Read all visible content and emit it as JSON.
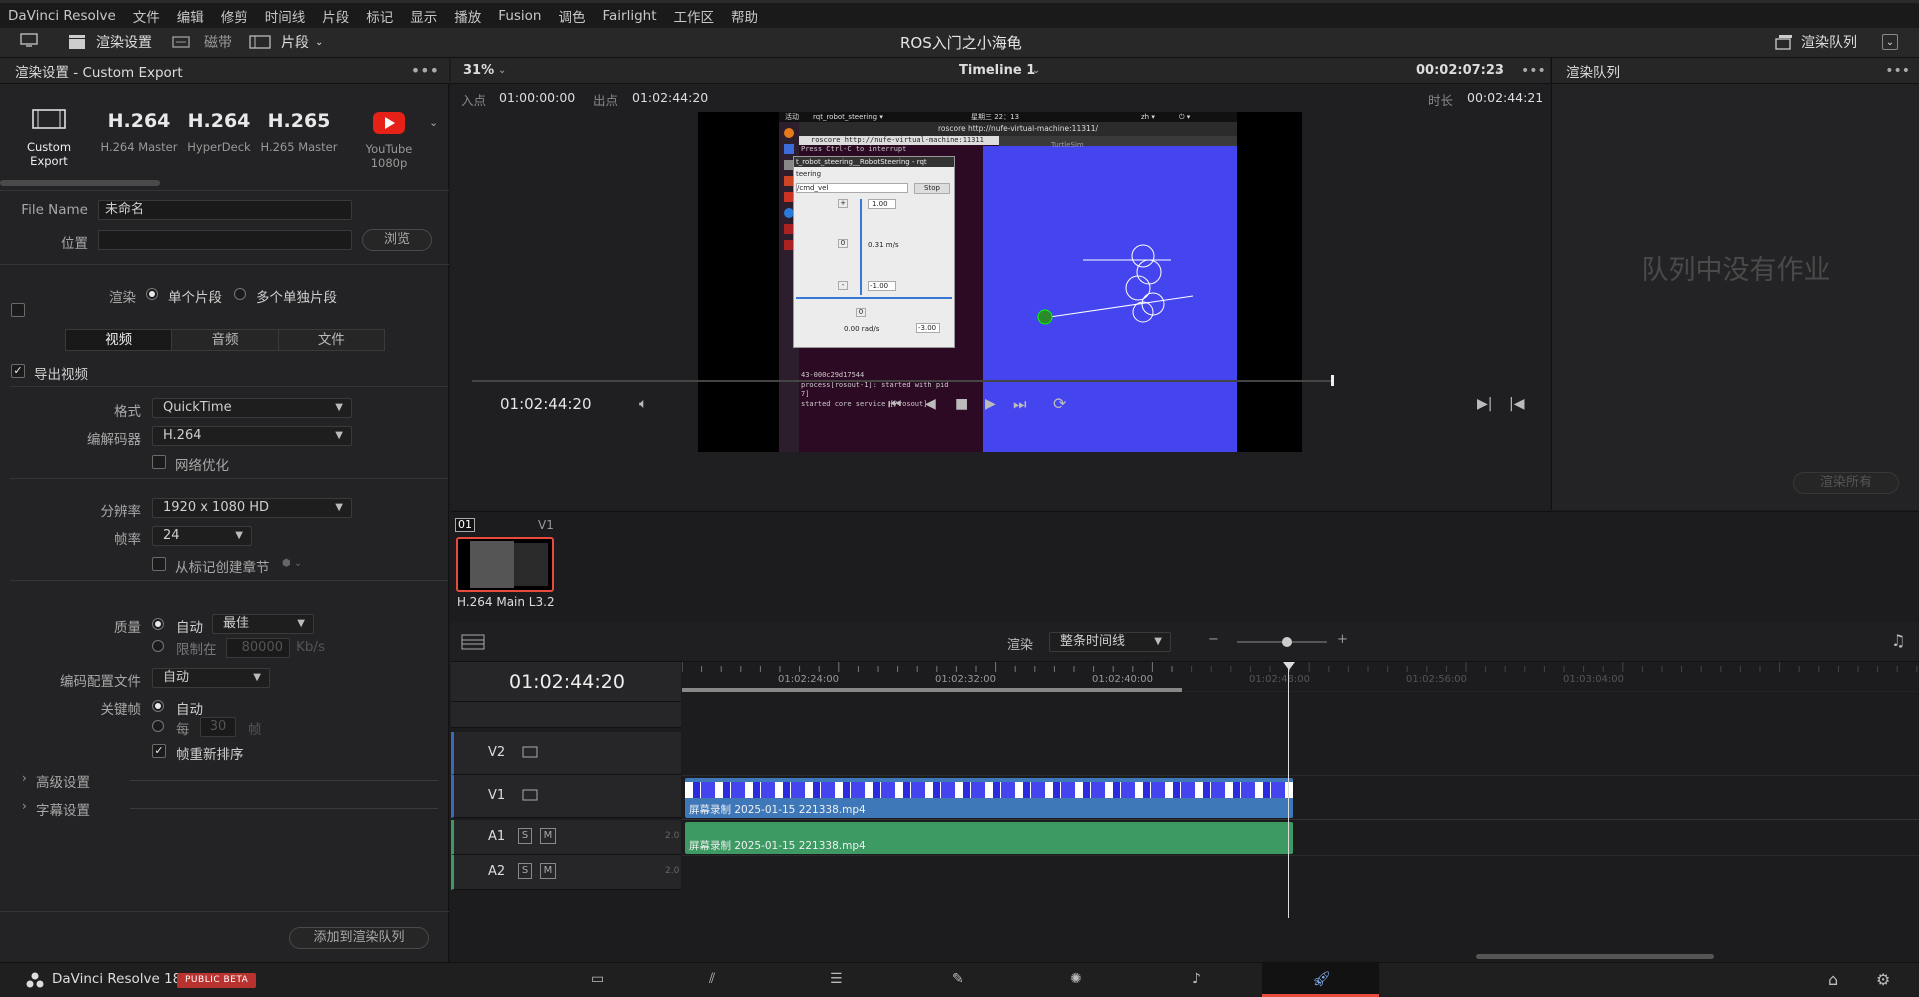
{
  "menubar": {
    "items": [
      "DaVinci Resolve",
      "文件",
      "编辑",
      "修剪",
      "时间线",
      "片段",
      "标记",
      "显示",
      "播放",
      "Fusion",
      "调色",
      "Fairlight",
      "工作区",
      "帮助"
    ]
  },
  "toolbar": {
    "render_settings": "渲染设置",
    "tape": "磁带",
    "clips": "片段",
    "project_title": "ROS入门之小海龟",
    "render_queue": "渲染队列"
  },
  "render_settings": {
    "title": "渲染设置 - Custom Export",
    "presets": [
      {
        "name": "Custom Export",
        "label": ""
      },
      {
        "name": "H.264 Master",
        "label": "H.264"
      },
      {
        "name": "HyperDeck",
        "label": "H.264"
      },
      {
        "name": "H.265 Master",
        "label": "H.265"
      },
      {
        "name": "YouTube 1080p",
        "label": ""
      }
    ],
    "file_name_label": "File Name",
    "file_name": "未命名",
    "location_label": "位置",
    "location": "",
    "browse": "浏览",
    "render_label": "渲染",
    "single_clip": "单个片段",
    "multiple_clips": "多个单独片段",
    "tabs": [
      "视频",
      "音频",
      "文件"
    ],
    "export_video": "导出视频",
    "format_label": "格式",
    "format": "QuickTime",
    "codec_label": "编解码器",
    "codec": "H.264",
    "network_opt": "网络优化",
    "resolution_label": "分辨率",
    "resolution": "1920 x 1080 HD",
    "fps_label": "帧率",
    "fps": "24",
    "chapters": "从标记创建章节",
    "quality_label": "质量",
    "quality_auto": "自动",
    "quality": "最佳",
    "limit_label": "限制在",
    "limit_value": "80000",
    "limit_unit": "Kb/s",
    "profile_label": "编码配置文件",
    "profile": "自动",
    "keyframe_label": "关键帧",
    "keyframe_auto": "自动",
    "keyframe_every": "每",
    "keyframe_value": "30",
    "keyframe_unit": "帧",
    "reorder": "帧重新排序",
    "advanced": "高级设置",
    "subtitle": "字幕设置",
    "add_queue": "添加到渲染队列"
  },
  "viewer": {
    "zoom": "31%",
    "timeline": "Timeline 1",
    "tc_top": "00:02:07:23",
    "in_label": "入点",
    "in_tc": "01:00:00:00",
    "out_label": "出点",
    "out_tc": "01:02:44:20",
    "dur_label": "时长",
    "dur_tc": "00:02:44:21",
    "current_tc": "01:02:44:20",
    "screen": {
      "top_bar_left": "活动",
      "app": "rqt_robot_steering ▾",
      "clock": "星期三 22：13",
      "lang": "zh ▾",
      "terminal_title": "roscore http://nufe-virtual-machine:11311/",
      "term_tab": "roscore http://nufe-virtual-machine:11311",
      "term_line1": "Press Ctrl-C to interrupt",
      "steer_title": "t_robot_steering__RobotSteering - rqt",
      "steer_sub": "teering",
      "topic": "/cmd_vel",
      "stop": "Stop",
      "max_lin": "1.00",
      "lin_val": "0.31 m/s",
      "min_lin": "-1.00",
      "zero1": "0",
      "zero2": "0",
      "ang_val": "0.00 rad/s",
      "ang_min": "-3.00",
      "plus": "+",
      "minus": "-",
      "term_line2": "43-000c29d17544",
      "term_line3": "process[rosout-1]: started with pid",
      "term_line4": "7]",
      "term_line5": "started core service [/rosout]",
      "turtlesim": "TurtleSim"
    }
  },
  "clip": {
    "index": "01",
    "track": "V1",
    "codec": "H.264 Main L3.2"
  },
  "render_queue": {
    "title": "渲染队列",
    "empty": "队列中没有作业",
    "render_all": "渲染所有"
  },
  "timeline": {
    "render_label": "渲染",
    "render_mode": "整条时间线",
    "timecode": "01:02:44:20",
    "ruler": [
      "01:02:24:00",
      "01:02:32:00",
      "01:02:40:00",
      "01:02:48:00",
      "01:02:56:00",
      "01:03:04:00"
    ],
    "tracks": [
      {
        "name": "V2"
      },
      {
        "name": "V1"
      },
      {
        "name": "A1",
        "s": "S",
        "m": "M",
        "ch": "2.0"
      },
      {
        "name": "A2",
        "s": "S",
        "m": "M",
        "ch": "2.0"
      }
    ],
    "clip_name": "屏幕录制 2025-01-15 221338.mp4"
  },
  "footer": {
    "app": "DaVinci Resolve 18",
    "badge": "PUBLIC BETA"
  },
  "colors": {
    "accent": "#e64b3c",
    "video_clip": "#3f78b8",
    "audio_clip": "#3c9a62",
    "turtle_bg": "#4545f0"
  }
}
